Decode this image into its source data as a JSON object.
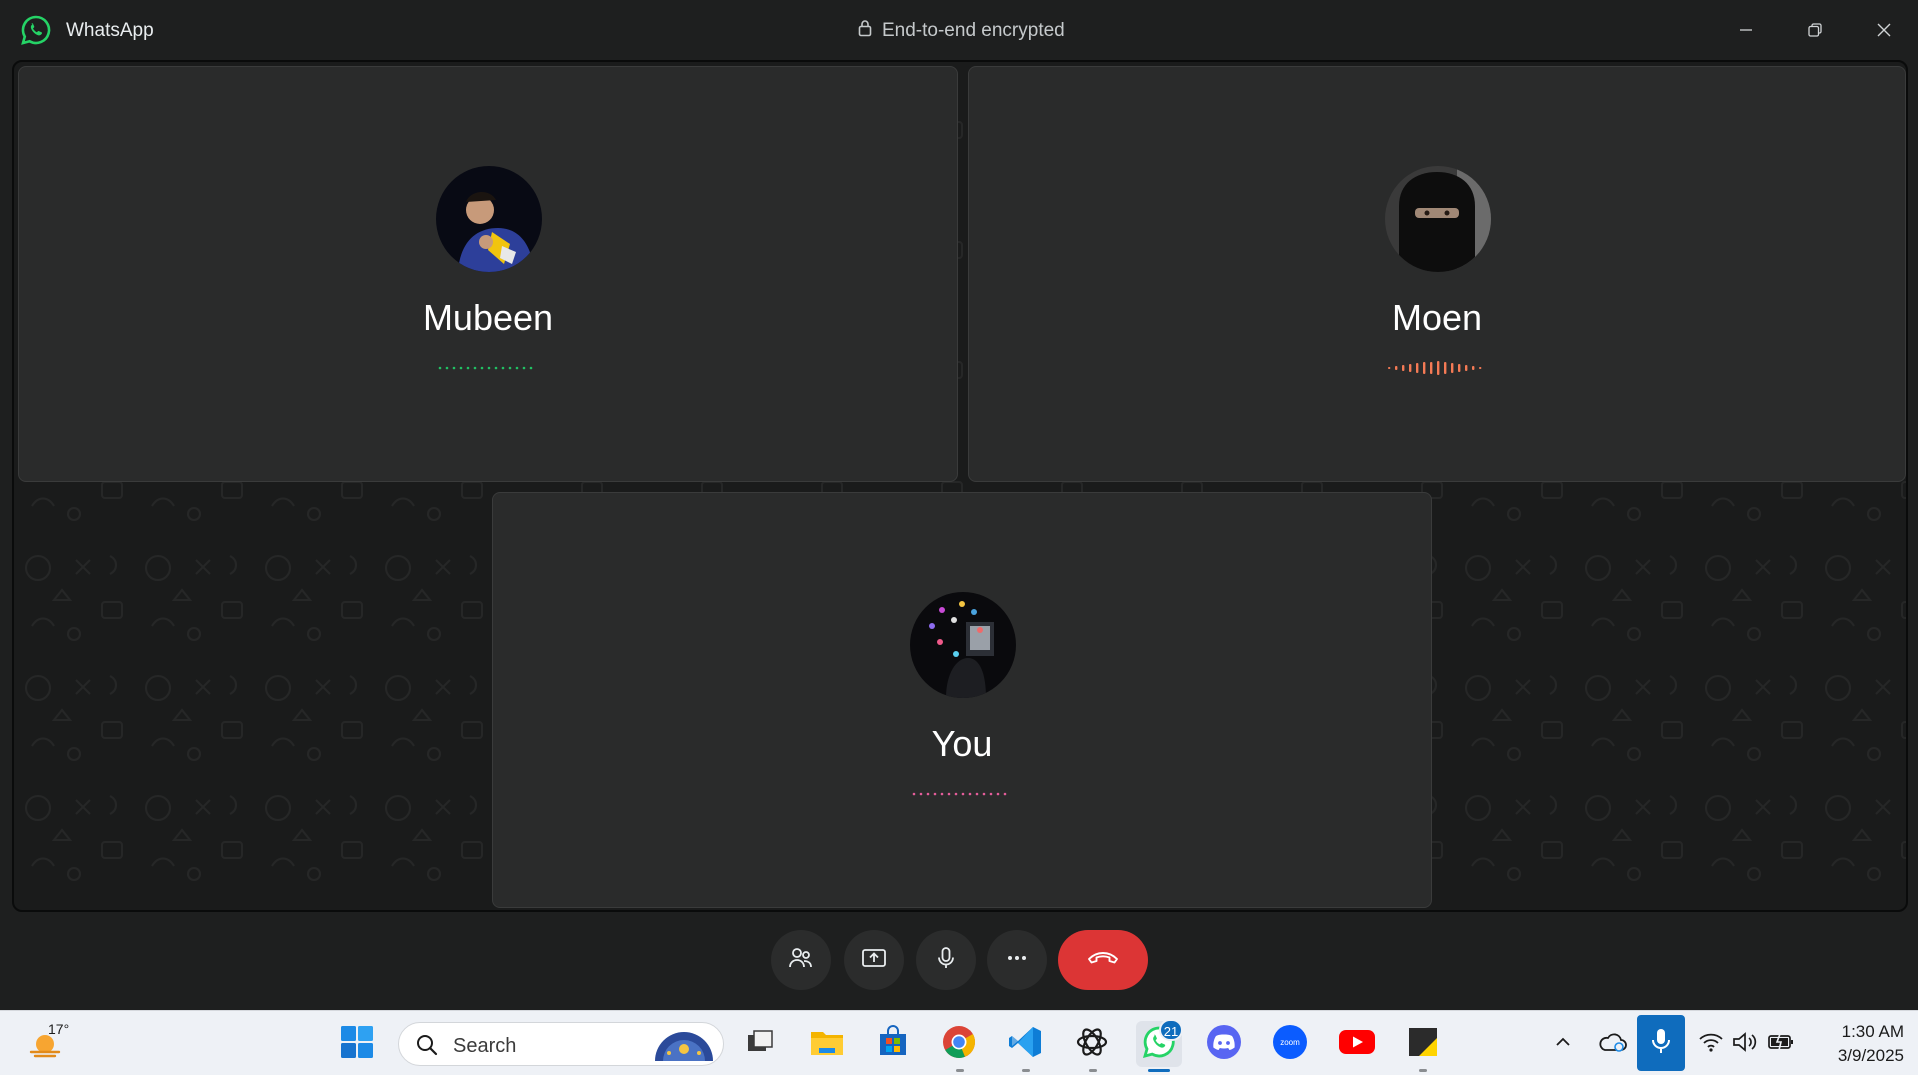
{
  "app": {
    "name": "WhatsApp",
    "encryption_label": "End-to-end encrypted"
  },
  "participants": [
    {
      "name": "Mubeen",
      "wave_color": "#21c063"
    },
    {
      "name": "Moen",
      "wave_color": "#f47a55"
    },
    {
      "name": "You",
      "wave_color": "#e45d9a"
    }
  ],
  "controls": {
    "participants_icon": "people-icon",
    "share_icon": "share-screen-icon",
    "mic_icon": "microphone-icon",
    "more_icon": "more-icon",
    "end_icon": "end-call-icon",
    "end_color": "#dc3535"
  },
  "taskbar": {
    "weather_temp": "17°",
    "search_label": "Search",
    "whatsapp_badge": "21",
    "clock_time": "1:30 AM",
    "clock_date": "3/9/2025"
  }
}
